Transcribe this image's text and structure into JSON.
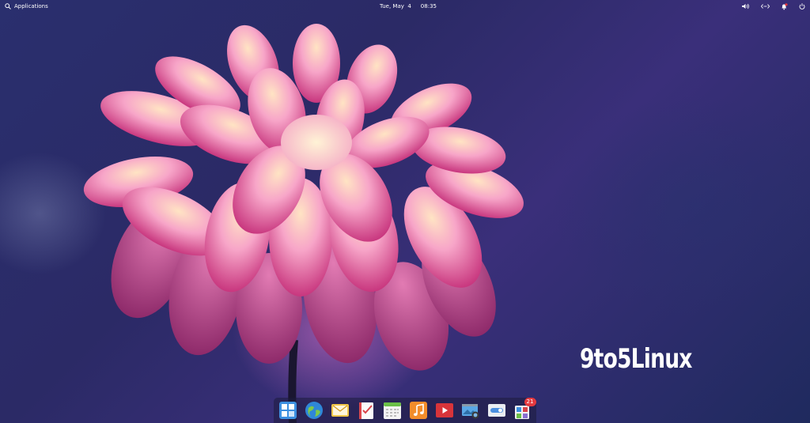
{
  "panel": {
    "applications_label": "Applications",
    "date": "Tue, May  4",
    "time": "08:35"
  },
  "watermark": "9to5Linux",
  "dock": {
    "apps": [
      {
        "icon": "multitasking-view-icon"
      },
      {
        "icon": "web-browser-icon"
      },
      {
        "icon": "mail-icon"
      },
      {
        "icon": "tasks-icon"
      },
      {
        "icon": "calendar-icon"
      },
      {
        "icon": "music-icon"
      },
      {
        "icon": "videos-icon"
      },
      {
        "icon": "photos-icon"
      },
      {
        "icon": "system-settings-icon"
      },
      {
        "icon": "appcenter-icon",
        "badge": "21"
      }
    ]
  },
  "colors": {
    "panel_text": "#ffffff",
    "badge": "#e4393f",
    "background": "#2b2a66",
    "petal": "#e0609a"
  }
}
